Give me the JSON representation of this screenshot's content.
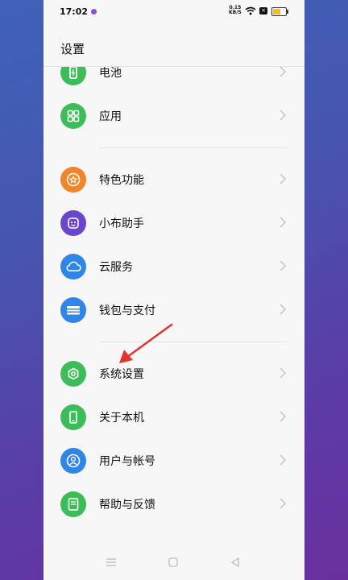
{
  "status_bar": {
    "time": "17:02",
    "net_speed_value": "0.15",
    "net_speed_unit": "KB/S",
    "battery_level": 0.6,
    "battery_color": "#f2c21b"
  },
  "header": {
    "title": "设置"
  },
  "items": [
    {
      "label": "电池",
      "icon": "battery-icon",
      "color": "#3dbd5a"
    },
    {
      "label": "应用",
      "icon": "apps-grid-icon",
      "color": "#3dbd5a"
    },
    {
      "label": "特色功能",
      "icon": "star-icon",
      "color": "#f0852a"
    },
    {
      "label": "小布助手",
      "icon": "assistant-icon",
      "color": "#6a46c8"
    },
    {
      "label": "云服务",
      "icon": "cloud-icon",
      "color": "#2f86e6"
    },
    {
      "label": "钱包与支付",
      "icon": "wallet-icon",
      "color": "#2f86e6"
    },
    {
      "label": "系统设置",
      "icon": "system-settings-icon",
      "color": "#3dbd5a"
    },
    {
      "label": "关于本机",
      "icon": "phone-icon",
      "color": "#3dbd5a"
    },
    {
      "label": "用户与帐号",
      "icon": "user-icon",
      "color": "#2f86e6"
    },
    {
      "label": "帮助与反馈",
      "icon": "help-icon",
      "color": "#3dbd5a"
    }
  ],
  "annotation": {
    "arrow_color": "#e3342f"
  }
}
